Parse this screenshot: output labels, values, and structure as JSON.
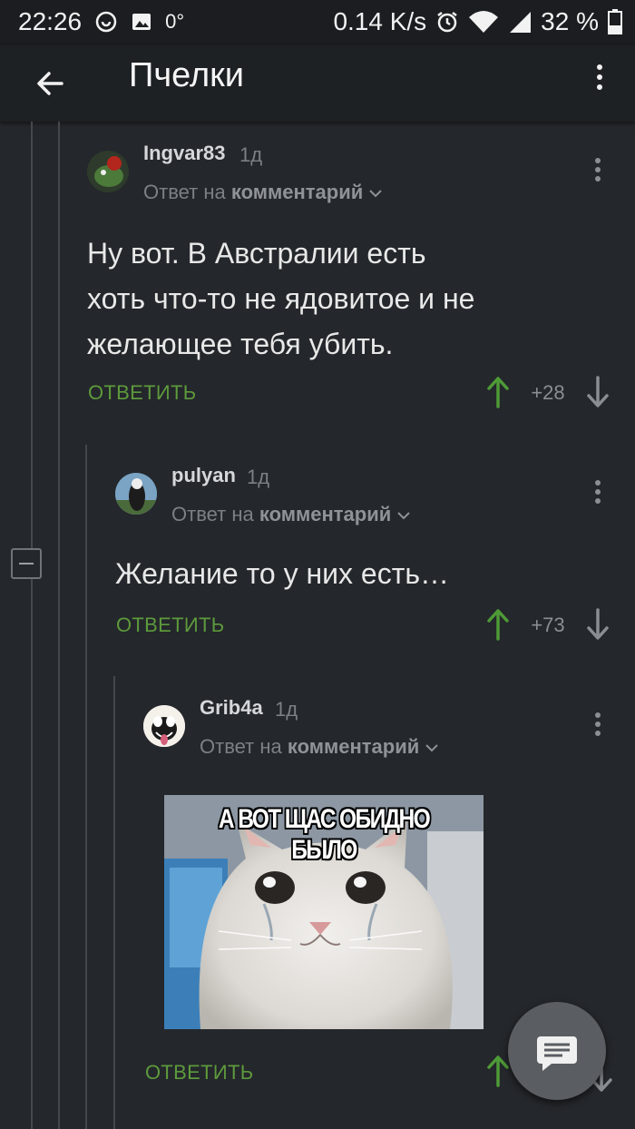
{
  "status_bar": {
    "time": "22:26",
    "temperature": "0°",
    "network_speed": "0.14 K/s",
    "battery": "32 %",
    "icons": [
      "sync-icon",
      "image-icon",
      "alarm-icon",
      "wifi-icon",
      "signal-icon",
      "battery-icon"
    ]
  },
  "app_bar": {
    "title": "Пчелки",
    "back_icon": "arrow-left-icon",
    "menu_icon": "more-vertical-icon"
  },
  "comments": [
    {
      "username": "Ingvar83",
      "age": "1д",
      "reply_prefix": "Ответ на",
      "reply_target": "комментарий",
      "text_lines": [
        "Ну вот. В Австралии есть",
        "хоть что-то не ядовитое и не",
        "желающее тебя убить."
      ],
      "reply_label": "ОТВЕТИТЬ",
      "score": "+28"
    },
    {
      "username": "pulyan",
      "age": "1д",
      "reply_prefix": "Ответ на",
      "reply_target": "комментарий",
      "text_lines": [
        "Желание то у них есть…"
      ],
      "reply_label": "ОТВЕТИТЬ",
      "score": "+73"
    },
    {
      "username": "Grib4a",
      "age": "1д",
      "reply_prefix": "Ответ на",
      "reply_target": "комментарий",
      "image_caption": "А ВОТ ЩАС ОБИДНО БЫЛО",
      "reply_label": "ОТВЕТИТЬ"
    }
  ],
  "colors": {
    "background": "#24272b",
    "reply_green": "#5d9a3c",
    "upvote_green": "#4e9a37"
  },
  "fab": {
    "icon": "comment-icon"
  }
}
